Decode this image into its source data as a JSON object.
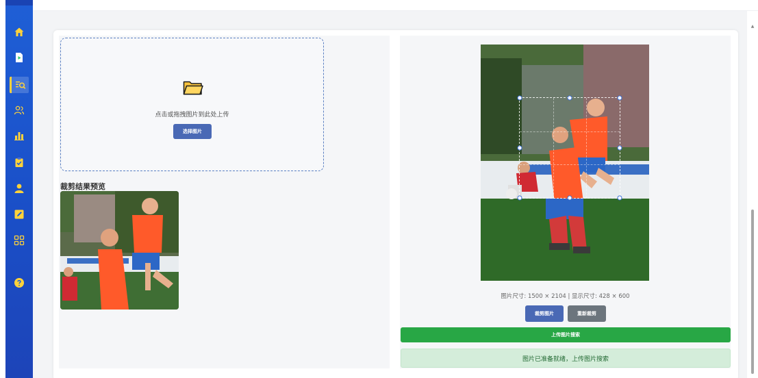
{
  "sidebar": {
    "items": [
      {
        "icon": "home-icon",
        "active": false
      },
      {
        "icon": "video-file-icon",
        "active": false
      },
      {
        "icon": "image-search-icon",
        "active": true
      },
      {
        "icon": "users-icon",
        "active": false
      },
      {
        "icon": "bar-chart-icon",
        "active": false
      },
      {
        "icon": "clipboard-check-icon",
        "active": false
      },
      {
        "icon": "user-icon",
        "active": false
      },
      {
        "icon": "edit-icon",
        "active": false
      },
      {
        "icon": "grid-apps-icon",
        "active": false
      },
      {
        "icon": "help-icon",
        "active": false
      }
    ],
    "accent": "#ffd23a"
  },
  "upload": {
    "hint": "点击或拖拽图片到此处上传",
    "select_label": "选择图片"
  },
  "preview": {
    "title": "裁剪结果预览"
  },
  "cropper": {
    "info": "图片尺寸: 1500 × 2104 | 显示尺寸: 428 × 600",
    "crop_label": "裁剪图片",
    "recrop_label": "重新裁剪",
    "upload_label": "上传图片搜索",
    "status": "图片已准备就绪，上传图片搜索"
  },
  "colors": {
    "primary": "#4a69b5",
    "secondary": "#6c757d",
    "success": "#28a745",
    "success_bg": "#d4edda"
  }
}
